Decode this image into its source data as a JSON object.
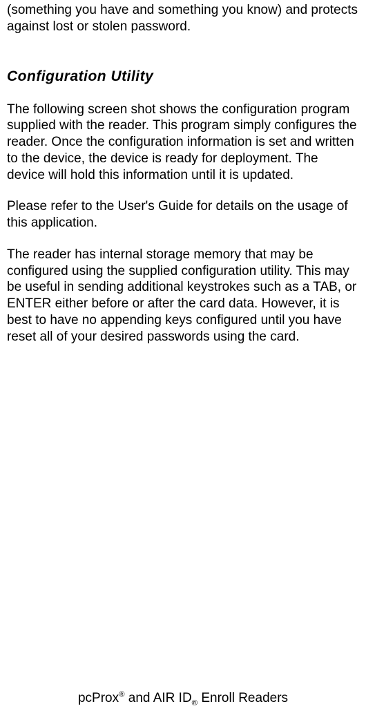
{
  "lead_fragment": "(something you have and something you know) and protects against lost or stolen password.",
  "section_heading": "Configuration Utility",
  "para1": "The following screen shot shows the configuration program supplied with the reader. This program simply configures the reader. Once the configuration information is set and written to the device, the device is ready for deployment. The device will hold this information until it is updated.",
  "para2": "Please refer to the User's Guide for details on the usage of this application.",
  "para3": "The reader has internal storage memory that may be configured using the supplied configuration utility. This may be useful in sending additional keystrokes such as a TAB, or ENTER either before or after the card data. However, it is best to have no appending keys configured until you have reset all of your desired passwords using the card.",
  "footer_prefix": "pcProx",
  "footer_mid": " and AIR ID",
  "footer_suffix": " Enroll Readers",
  "reg_mark": "®"
}
